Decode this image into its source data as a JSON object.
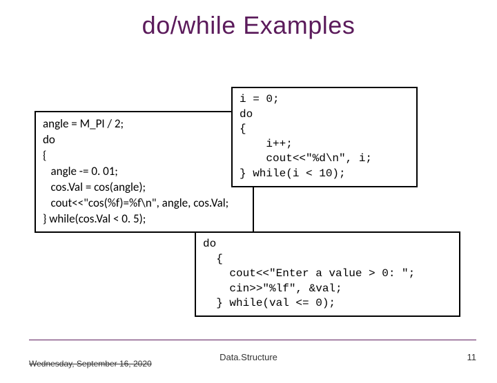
{
  "title": "do/while Examples",
  "box1": {
    "l1": "angle = M_PI / 2;",
    "l2": "do",
    "l3": "{",
    "l4": "   angle -= 0. 01;",
    "l5": "   cos.Val = cos(angle);",
    "l6": "   cout<<\"cos(%f)=%f\\n\", angle, cos.Val;",
    "l7": "} while(cos.Val < 0. 5);"
  },
  "box2": {
    "l1": "i = 0;",
    "l2": "do",
    "l3": "{",
    "l4": "    i++;",
    "l5": "    cout<<\"%d\\n\", i;",
    "l6": "} while(i < 10);"
  },
  "box3": {
    "l1": "do",
    "l2": "  {",
    "l3": "    cout<<\"Enter a value > 0: \";",
    "l4": "    cin>>\"%lf\", &val;",
    "l5": "  } while(val <= 0);"
  },
  "footer": {
    "date": "Wednesday, September 16, 2020",
    "center": "Data.Structure",
    "page": "11"
  }
}
